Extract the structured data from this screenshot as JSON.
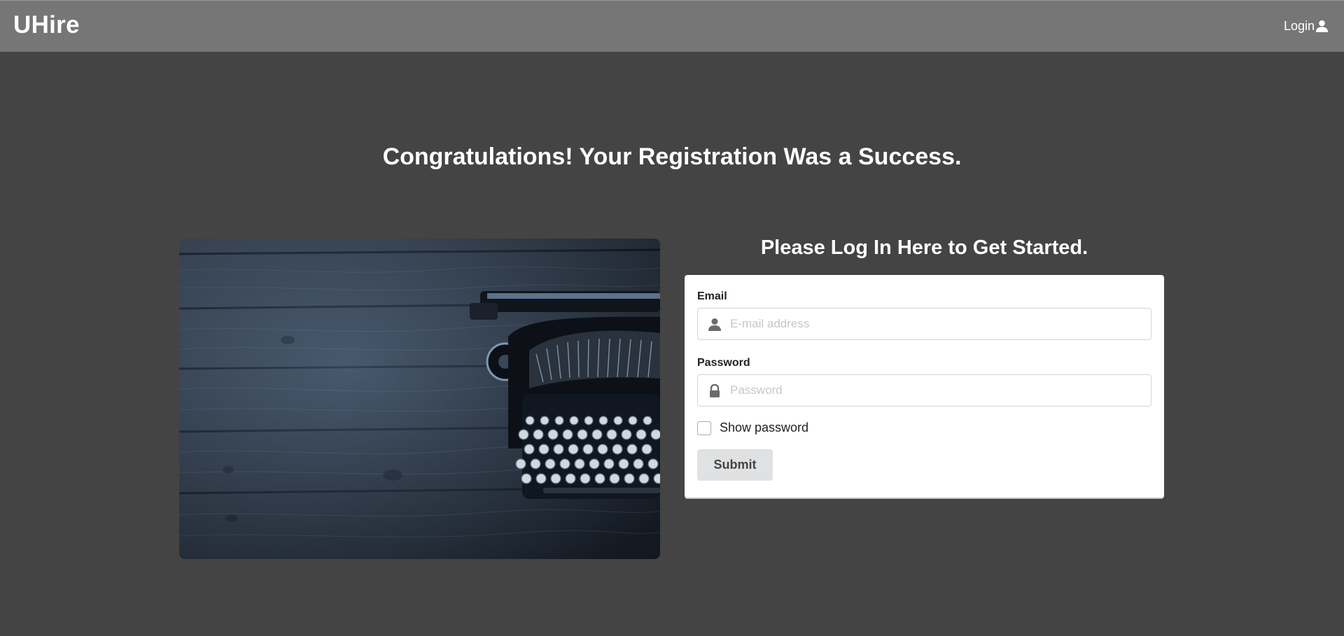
{
  "header": {
    "brand": "UHire",
    "login_label": "Login",
    "login_icon": "user-icon"
  },
  "main": {
    "headline": "Congratulations! Your Registration Was a Success.",
    "hero_image": "typewriter-on-wooden-table",
    "login_heading": "Please Log In Here to Get Started."
  },
  "form": {
    "email": {
      "label": "Email",
      "placeholder": "E-mail address",
      "value": "",
      "icon": "user-icon"
    },
    "password": {
      "label": "Password",
      "placeholder": "Password",
      "value": "",
      "icon": "lock-icon"
    },
    "show_password_label": "Show password",
    "show_password_checked": false,
    "submit_label": "Submit"
  },
  "colors": {
    "page_background": "#444444",
    "navbar_background": "#767676",
    "card_background": "#ffffff",
    "button_background": "#e0e1e2"
  }
}
